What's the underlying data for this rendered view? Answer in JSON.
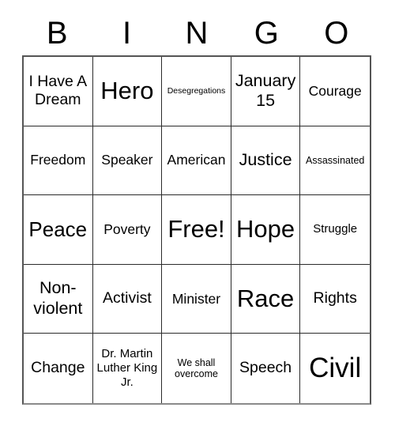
{
  "card": {
    "type": "bingo-card",
    "header_letters": [
      "B",
      "I",
      "N",
      "G",
      "O"
    ],
    "columns": 5,
    "rows": 5,
    "colors": {
      "background": "#ffffff",
      "text": "#000000",
      "grid_line": "#2b2b2b",
      "outer_border": "#555555"
    },
    "cells": [
      {
        "text": "I Have A Dream",
        "size": "ml"
      },
      {
        "text": "Hero",
        "size": "xxl"
      },
      {
        "text": "Desegregations",
        "size": "xs"
      },
      {
        "text": "January 15",
        "size": "l"
      },
      {
        "text": "Courage",
        "size": "m"
      },
      {
        "text": "Freedom",
        "size": "m"
      },
      {
        "text": "Speaker",
        "size": "m"
      },
      {
        "text": "American",
        "size": "m"
      },
      {
        "text": "Justice",
        "size": "l"
      },
      {
        "text": "Assassinated",
        "size": "s"
      },
      {
        "text": "Peace",
        "size": "xl"
      },
      {
        "text": "Poverty",
        "size": "m"
      },
      {
        "text": "Free!",
        "size": "xxl"
      },
      {
        "text": "Hope",
        "size": "xxl"
      },
      {
        "text": "Struggle",
        "size": "sm"
      },
      {
        "text": "Non-violent",
        "size": "l"
      },
      {
        "text": "Activist",
        "size": "ml"
      },
      {
        "text": "Minister",
        "size": "m"
      },
      {
        "text": "Race",
        "size": "xxl"
      },
      {
        "text": "Rights",
        "size": "ml"
      },
      {
        "text": "Change",
        "size": "ml"
      },
      {
        "text": "Dr. Martin Luther King Jr.",
        "size": "sm"
      },
      {
        "text": "We shall overcome",
        "size": "s"
      },
      {
        "text": "Speech",
        "size": "ml"
      },
      {
        "text": "Civil",
        "size": "huge"
      }
    ]
  }
}
